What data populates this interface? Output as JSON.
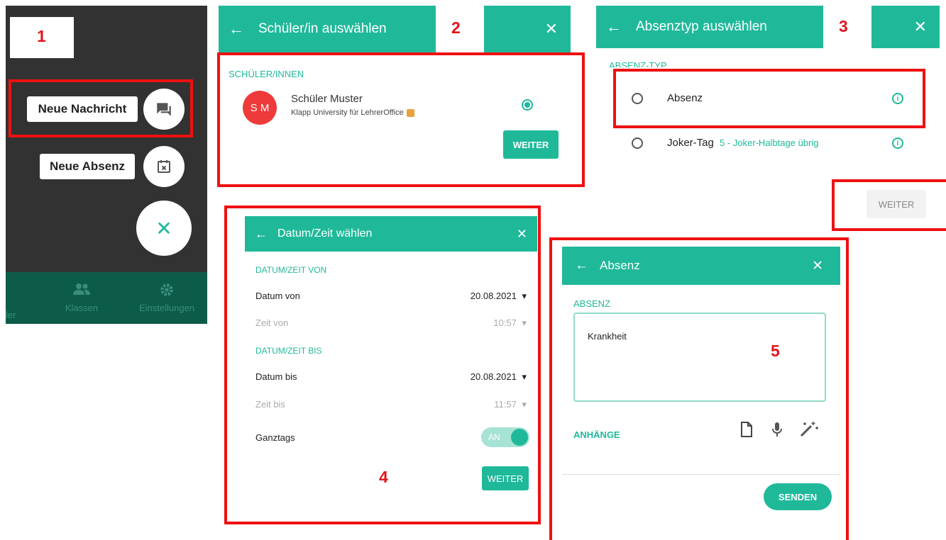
{
  "colors": {
    "accent": "#1fb99a",
    "annotation": "#ee1111",
    "dark_bg": "#323232",
    "nav_bg": "#0d5c4a"
  },
  "panel1": {
    "step": "1",
    "new_message_label": "Neue Nachricht",
    "new_absence_label": "Neue Absenz",
    "nav_items": [
      "ler",
      "Klassen",
      "Einstellungen"
    ],
    "icons": [
      "chat-icon",
      "calendar-x-icon",
      "close-icon",
      "people-icon",
      "gear-icon"
    ]
  },
  "panel2": {
    "step": "2",
    "title": "Schüler/in auswählen",
    "section": "SCHÜLER/INNEN",
    "avatar": "S M",
    "student_name": "Schüler Muster",
    "student_sub": "Klapp University für LehrerOffice",
    "next": "WEITER"
  },
  "panel3": {
    "step": "3",
    "title": "Absenztyp auswählen",
    "section": "ABSENZ-TYP",
    "options": [
      {
        "label": "Absenz",
        "note": ""
      },
      {
        "label": "Joker-Tag",
        "note": "5 - Joker-Halbtage übrig"
      }
    ],
    "next": "WEITER"
  },
  "panel4": {
    "step": "4",
    "title": "Datum/Zeit wählen",
    "from_section": "DATUM/ZEIT VON",
    "date_from_label": "Datum von",
    "date_from": "20.08.2021",
    "time_from_label": "Zeit von",
    "time_from": "10:57",
    "to_section": "DATUM/ZEIT BIS",
    "date_to_label": "Datum bis",
    "date_to": "20.08.2021",
    "time_to_label": "Zeit bis",
    "time_to": "11:57",
    "fullday_label": "Ganztags",
    "toggle_text": "AN",
    "next": "WEITER"
  },
  "panel5": {
    "step": "5",
    "title": "Absenz",
    "section": "ABSENZ",
    "text_value": "Krankheit",
    "attachments": "ANHÄNGE",
    "send": "SENDEN"
  },
  "glyphs": {
    "back": "←",
    "close": "✕",
    "caret": "▾"
  }
}
